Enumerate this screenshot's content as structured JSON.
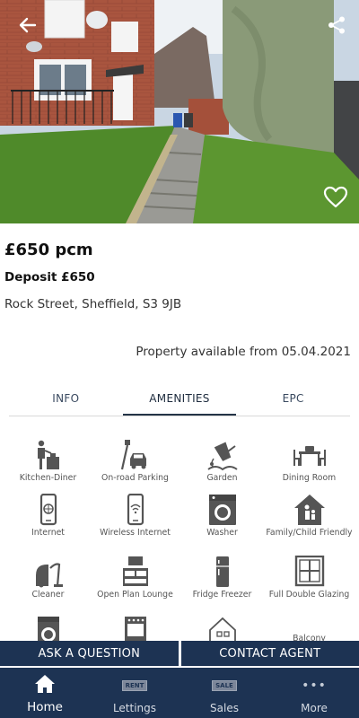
{
  "listing": {
    "price": "£650 pcm",
    "deposit": "Deposit £650",
    "address": "Rock Street, Sheffield, S3 9JB",
    "availability": "Property available from 05.04.2021"
  },
  "tabs": [
    {
      "label": "INFO",
      "active": false
    },
    {
      "label": "AMENITIES",
      "active": true
    },
    {
      "label": "EPC",
      "active": false
    }
  ],
  "amenities": [
    {
      "label": "Kitchen-Diner",
      "icon": "kitchen-diner-icon"
    },
    {
      "label": "On-road Parking",
      "icon": "parking-icon"
    },
    {
      "label": "Garden",
      "icon": "garden-icon"
    },
    {
      "label": "Dining Room",
      "icon": "dining-table-icon"
    },
    {
      "label": "Internet",
      "icon": "internet-icon"
    },
    {
      "label": "Wireless Internet",
      "icon": "wifi-phone-icon"
    },
    {
      "label": "Washer",
      "icon": "washer-icon"
    },
    {
      "label": "Family/Child Friendly",
      "icon": "family-icon"
    },
    {
      "label": "Cleaner",
      "icon": "vacuum-icon"
    },
    {
      "label": "Open Plan Lounge",
      "icon": "lounge-icon"
    },
    {
      "label": "Fridge Freezer",
      "icon": "fridge-icon"
    },
    {
      "label": "Full Double Glazing",
      "icon": "window-icon"
    },
    {
      "label": "",
      "icon": "dryer-icon"
    },
    {
      "label": "",
      "icon": "oven-icon"
    },
    {
      "label": "",
      "icon": "house-icon"
    },
    {
      "label": "Balcony",
      "icon": "balcony-icon"
    }
  ],
  "actions": {
    "ask": "ASK A QUESTION",
    "contact": "CONTACT AGENT"
  },
  "nav": [
    {
      "label": "Home",
      "icon": "home-icon",
      "active": true
    },
    {
      "label": "Lettings",
      "icon": "rent-sign-icon",
      "sign": "RENT",
      "active": false
    },
    {
      "label": "Sales",
      "icon": "sale-sign-icon",
      "sign": "SALE",
      "active": false
    },
    {
      "label": "More",
      "icon": "more-dots-icon",
      "sign": "•••",
      "active": false
    }
  ],
  "colors": {
    "brand_navy": "#1d3353",
    "icon_gray": "#555555"
  }
}
